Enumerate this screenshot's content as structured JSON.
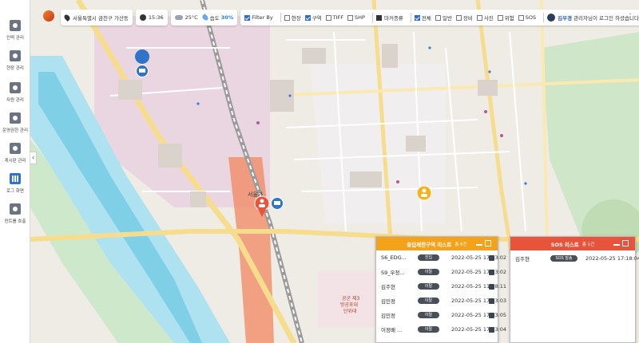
{
  "header": {
    "location": "서울특별시 금천구 가산동",
    "time": "15:36",
    "temperature": "25°C",
    "humidity_label": "습도",
    "humidity_value": "30%",
    "filter_label": "Filter By",
    "filters": [
      {
        "label": "현장",
        "checked": false
      },
      {
        "label": "구역",
        "checked": true
      },
      {
        "label": "TIFF",
        "checked": false
      },
      {
        "label": "SHP",
        "checked": false
      }
    ],
    "marker_label": "마커종류",
    "markers": [
      {
        "label": "전체",
        "checked": true
      },
      {
        "label": "일반",
        "checked": false
      },
      {
        "label": "장비",
        "checked": false
      },
      {
        "label": "사진",
        "checked": false
      },
      {
        "label": "위험",
        "checked": false
      },
      {
        "label": "SOS",
        "checked": false
      }
    ],
    "user_name": "김우경",
    "user_suffix": "관리자님이 로그인 하셨습니다.",
    "more_icon": "⋮"
  },
  "sidebar": {
    "collapse_icon": "‹",
    "items": [
      {
        "label": "인력 관리",
        "icon": "person-icon"
      },
      {
        "label": "현장 관리",
        "icon": "site-icon"
      },
      {
        "label": "자원 관리",
        "icon": "resource-icon"
      },
      {
        "label": "운영권한 관리",
        "icon": "permission-icon"
      },
      {
        "label": "게시판 관리",
        "icon": "board-icon"
      },
      {
        "label": "로그 화면",
        "icon": "log-icon"
      },
      {
        "label": "컨트롤 호출",
        "icon": "control-icon"
      }
    ],
    "active_index": 5
  },
  "map": {
    "labels": [
      {
        "text": "서울가",
        "type": "area"
      },
      {
        "text": "공군 제3\n방공포대\n단위대",
        "type": "area"
      }
    ]
  },
  "restricted_panel": {
    "title": "출입제한구역 리스트",
    "count": "총 6건",
    "header_color": "#f5a21b",
    "rows": [
      {
        "name": "S6_EDG...",
        "status": "진입",
        "time": "2022-05-25 17:13:02"
      },
      {
        "name": "S9_우정...",
        "status": "이탈",
        "time": "2022-05-25 17:13:02"
      },
      {
        "name": "김주현",
        "status": "이탈",
        "time": "2022-05-25 11:58:11"
      },
      {
        "name": "김민정",
        "status": "이탈",
        "time": "2022-05-25 17:13:03"
      },
      {
        "name": "김민정",
        "status": "이탈",
        "time": "2022-05-25 17:13:05"
      },
      {
        "name": "이정배 ...",
        "status": "이탈",
        "time": "2022-05-25 17:13:04"
      }
    ]
  },
  "sos_panel": {
    "title": "SOS 리스트",
    "count": "총 1건",
    "header_color": "#e8533b",
    "rows": [
      {
        "name": "김주현",
        "status": "SOS 발송",
        "time": "2022-05-25 17:18:04"
      }
    ]
  }
}
